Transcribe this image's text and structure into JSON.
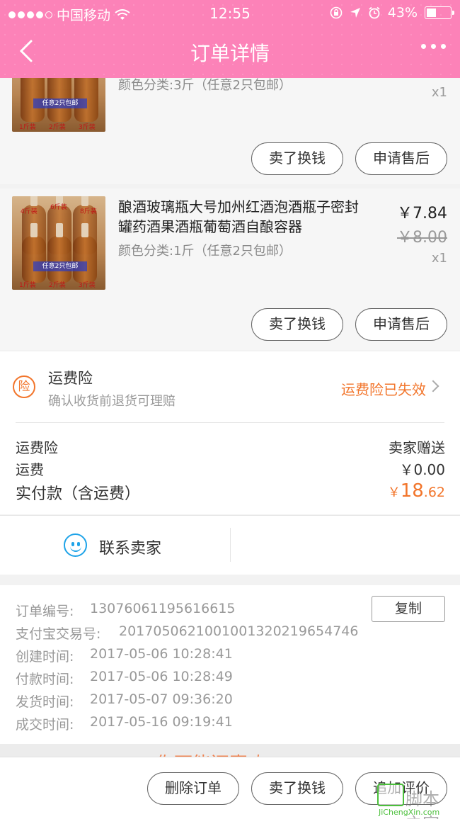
{
  "status_bar": {
    "carrier": "中国移动",
    "time": "12:55",
    "battery": "43%",
    "battery_level": 0.43
  },
  "nav": {
    "title": "订单详情"
  },
  "products": [
    {
      "sku": "颜色分类:3斤（任意2只包邮）",
      "qty": "x1",
      "image_labels": [
        "1斤装",
        "2斤装",
        "3斤装"
      ],
      "image_band": "任意2只包邮",
      "buttons": [
        "卖了换钱",
        "申请售后"
      ]
    },
    {
      "title": "酿酒玻璃瓶大号加州红酒泡酒瓶子密封罐药酒果酒瓶葡萄酒自酿容器",
      "sku": "颜色分类:1斤（任意2只包邮）",
      "price": "￥7.84",
      "original_price": "￥8.00",
      "qty": "x1",
      "image_labels": [
        "4斤装",
        "6斤装",
        "8斤装",
        "1斤装",
        "2斤装",
        "3斤装"
      ],
      "image_band": "任意2只包邮",
      "buttons": [
        "卖了换钱",
        "申请售后"
      ]
    }
  ],
  "insurance": {
    "icon_label": "险",
    "title": "运费险",
    "subtitle": "确认收货前退货可理赔",
    "status": "运费险已失效"
  },
  "fees": [
    {
      "label": "运费险",
      "value": "卖家赠送"
    },
    {
      "label": "运费",
      "value": "￥0.00"
    }
  ],
  "total": {
    "label": "实付款（含运费）",
    "currency": "￥",
    "int": "18",
    "dec": ".62"
  },
  "contact": {
    "label": "联系卖家"
  },
  "order_info": {
    "copy_label": "复制",
    "rows": [
      {
        "label": "订单编号:",
        "value": "13076061195616615"
      },
      {
        "label": "支付宝交易号:",
        "value": "2017050621001001320219654746"
      },
      {
        "label": "创建时间:",
        "value": "2017-05-06 10:28:41"
      },
      {
        "label": "付款时间:",
        "value": "2017-05-06 10:28:49"
      },
      {
        "label": "发货时间:",
        "value": "2017-05-07 09:36:20"
      },
      {
        "label": "成交时间:",
        "value": "2017-05-16 09:19:41"
      }
    ]
  },
  "peek_text": "你可能还喜欢",
  "bottom_buttons": {
    "delete": "删除订单",
    "sell": "卖了换钱",
    "review": "追加评价"
  },
  "watermark": {
    "cn": "脚本之家",
    "en": "JiChengXin.com"
  },
  "colors": {
    "brand_pink": "#fc82b8",
    "accent_orange": "#f2752b",
    "contact_blue": "#1ea3e8"
  }
}
